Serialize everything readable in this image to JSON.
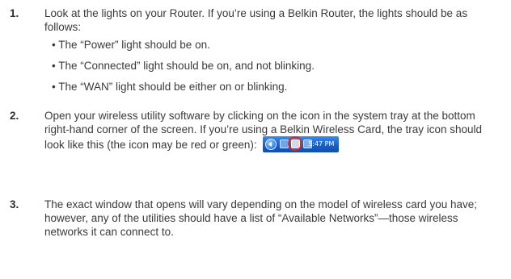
{
  "steps": [
    {
      "number": "1.",
      "text": "Look at the lights on your Router. If you’re using a Belkin Router, the lights should be as follows:",
      "bullets": [
        "• The “Power” light should be on.",
        "• The “Connected” light should be on, and not blinking.",
        "• The “WAN” light should be either on or blinking."
      ]
    },
    {
      "number": "2.",
      "text": "Open your wireless utility software by clicking on the icon in the system tray at the bottom right-hand corner of the screen. If you’re using a Belkin Wireless Card, the tray icon should look like this (the icon may be red or green):"
    },
    {
      "number": "3.",
      "text": "The exact window that opens will vary depending on the model of wireless card you have; however, any of the utilities should have a list of “Available Networks”—those wireless networks it can connect to."
    }
  ],
  "tray": {
    "time": "5:47 PM"
  },
  "colors": {
    "text": "#3a3a3a",
    "tray_blue": "#1760c9",
    "highlight_red": "#e0262b"
  }
}
